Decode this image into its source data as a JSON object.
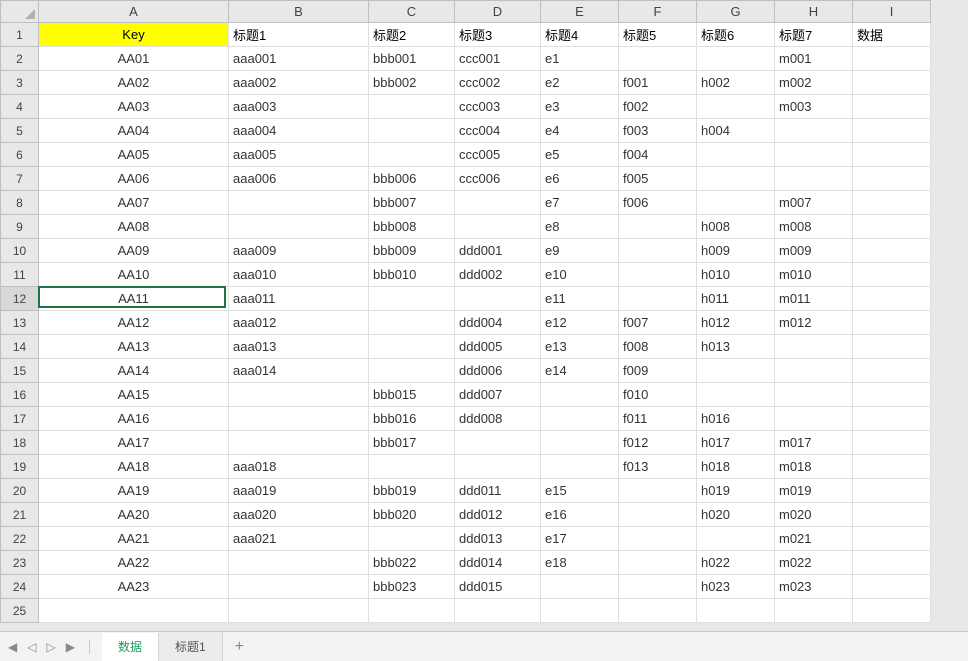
{
  "columns": [
    "A",
    "B",
    "C",
    "D",
    "E",
    "F",
    "G",
    "H",
    "I"
  ],
  "row_count": 25,
  "active_cell_row": 12,
  "active_cell_col": "A",
  "header_row": {
    "A": "Key",
    "B": "标题1",
    "C": "标题2",
    "D": "标题3",
    "E": "标题4",
    "F": "标题5",
    "G": "标题6",
    "H": "标题7",
    "I": "数据"
  },
  "rows": [
    {
      "A": "AA01",
      "B": "aaa001",
      "C": "bbb001",
      "D": "ccc001",
      "E": "e1",
      "F": "",
      "G": "",
      "H": "m001",
      "I": ""
    },
    {
      "A": "AA02",
      "B": "aaa002",
      "C": "bbb002",
      "D": "ccc002",
      "E": "e2",
      "F": "f001",
      "G": "h002",
      "H": "m002",
      "I": ""
    },
    {
      "A": "AA03",
      "B": "aaa003",
      "C": "",
      "D": "ccc003",
      "E": "e3",
      "F": "f002",
      "G": "",
      "H": "m003",
      "I": ""
    },
    {
      "A": "AA04",
      "B": "aaa004",
      "C": "",
      "D": "ccc004",
      "E": "e4",
      "F": "f003",
      "G": "h004",
      "H": "",
      "I": ""
    },
    {
      "A": "AA05",
      "B": "aaa005",
      "C": "",
      "D": "ccc005",
      "E": "e5",
      "F": "f004",
      "G": "",
      "H": "",
      "I": ""
    },
    {
      "A": "AA06",
      "B": "aaa006",
      "C": "bbb006",
      "D": "ccc006",
      "E": "e6",
      "F": "f005",
      "G": "",
      "H": "",
      "I": ""
    },
    {
      "A": "AA07",
      "B": "",
      "C": "bbb007",
      "D": "",
      "E": "e7",
      "F": "f006",
      "G": "",
      "H": "m007",
      "I": ""
    },
    {
      "A": "AA08",
      "B": "",
      "C": "bbb008",
      "D": "",
      "E": "e8",
      "F": "",
      "G": "h008",
      "H": "m008",
      "I": ""
    },
    {
      "A": "AA09",
      "B": "aaa009",
      "C": "bbb009",
      "D": "ddd001",
      "E": "e9",
      "F": "",
      "G": "h009",
      "H": "m009",
      "I": ""
    },
    {
      "A": "AA10",
      "B": "aaa010",
      "C": "bbb010",
      "D": "ddd002",
      "E": "e10",
      "F": "",
      "G": "h010",
      "H": "m010",
      "I": ""
    },
    {
      "A": "AA11",
      "B": "aaa011",
      "C": "",
      "D": "",
      "E": "e11",
      "F": "",
      "G": "h011",
      "H": "m011",
      "I": ""
    },
    {
      "A": "AA12",
      "B": "aaa012",
      "C": "",
      "D": "ddd004",
      "E": "e12",
      "F": "f007",
      "G": "h012",
      "H": "m012",
      "I": ""
    },
    {
      "A": "AA13",
      "B": "aaa013",
      "C": "",
      "D": "ddd005",
      "E": "e13",
      "F": "f008",
      "G": "h013",
      "H": "",
      "I": ""
    },
    {
      "A": "AA14",
      "B": "aaa014",
      "C": "",
      "D": "ddd006",
      "E": "e14",
      "F": "f009",
      "G": "",
      "H": "",
      "I": ""
    },
    {
      "A": "AA15",
      "B": "",
      "C": "bbb015",
      "D": "ddd007",
      "E": "",
      "F": "f010",
      "G": "",
      "H": "",
      "I": ""
    },
    {
      "A": "AA16",
      "B": "",
      "C": "bbb016",
      "D": "ddd008",
      "E": "",
      "F": "f011",
      "G": "h016",
      "H": "",
      "I": ""
    },
    {
      "A": "AA17",
      "B": "",
      "C": "bbb017",
      "D": "",
      "E": "",
      "F": "f012",
      "G": "h017",
      "H": "m017",
      "I": ""
    },
    {
      "A": "AA18",
      "B": "aaa018",
      "C": "",
      "D": "",
      "E": "",
      "F": "f013",
      "G": "h018",
      "H": "m018",
      "I": ""
    },
    {
      "A": "AA19",
      "B": "aaa019",
      "C": "bbb019",
      "D": "ddd011",
      "E": "e15",
      "F": "",
      "G": "h019",
      "H": "m019",
      "I": ""
    },
    {
      "A": "AA20",
      "B": "aaa020",
      "C": "bbb020",
      "D": "ddd012",
      "E": "e16",
      "F": "",
      "G": "h020",
      "H": "m020",
      "I": ""
    },
    {
      "A": "AA21",
      "B": "aaa021",
      "C": "",
      "D": "ddd013",
      "E": "e17",
      "F": "",
      "G": "",
      "H": "m021",
      "I": ""
    },
    {
      "A": "AA22",
      "B": "",
      "C": "bbb022",
      "D": "ddd014",
      "E": "e18",
      "F": "",
      "G": "h022",
      "H": "m022",
      "I": ""
    },
    {
      "A": "AA23",
      "B": "",
      "C": "bbb023",
      "D": "ddd015",
      "E": "",
      "F": "",
      "G": "h023",
      "H": "m023",
      "I": ""
    }
  ],
  "sheets": {
    "active": "数据",
    "tabs": [
      "数据",
      "标题1"
    ],
    "add_label": "+"
  },
  "nav_icons": {
    "first": "◀",
    "prev": "◁",
    "next": "▷",
    "last": "▶"
  }
}
